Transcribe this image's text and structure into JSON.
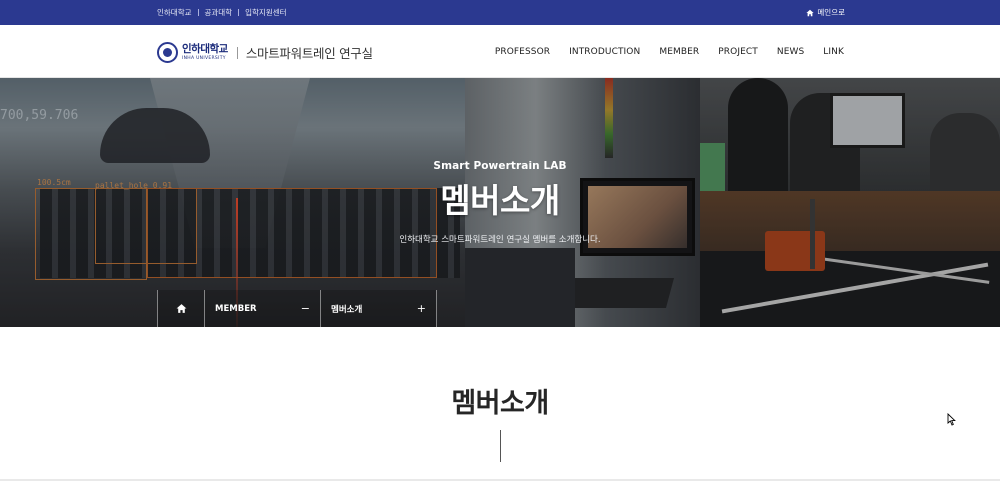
{
  "topbar": {
    "links": [
      "인하대학교",
      "공과대학",
      "입학지원센터"
    ],
    "home_label": "메인으로"
  },
  "header": {
    "logo_university": "인하대학교",
    "logo_university_en": "INHA UNIVERSITY",
    "lab_name": "스마트파워트레인 연구실",
    "nav": [
      "PROFESSOR",
      "INTRODUCTION",
      "MEMBER",
      "PROJECT",
      "NEWS",
      "LINK"
    ]
  },
  "hero": {
    "overlay_numbers": "700,59.706",
    "detect_label_1": "100.5cm",
    "detect_label_2": "pallet_hole 0.91",
    "subtitle": "Smart Powertrain LAB",
    "title": "멤버소개",
    "description": "인하대학교 스마트파워트레인 연구실 멤버를 소개합니다."
  },
  "breadcrumb": {
    "level1": "MEMBER",
    "level1_toggle": "−",
    "level2": "멤버소개",
    "level2_toggle": "+"
  },
  "content": {
    "section_title": "멤버소개"
  },
  "colors": {
    "topbar_bg": "#2b3990",
    "brand": "#1d2d7c"
  },
  "icons": {
    "home": "home-icon",
    "seal": "university-seal-icon",
    "cursor": "mouse-cursor-icon"
  }
}
